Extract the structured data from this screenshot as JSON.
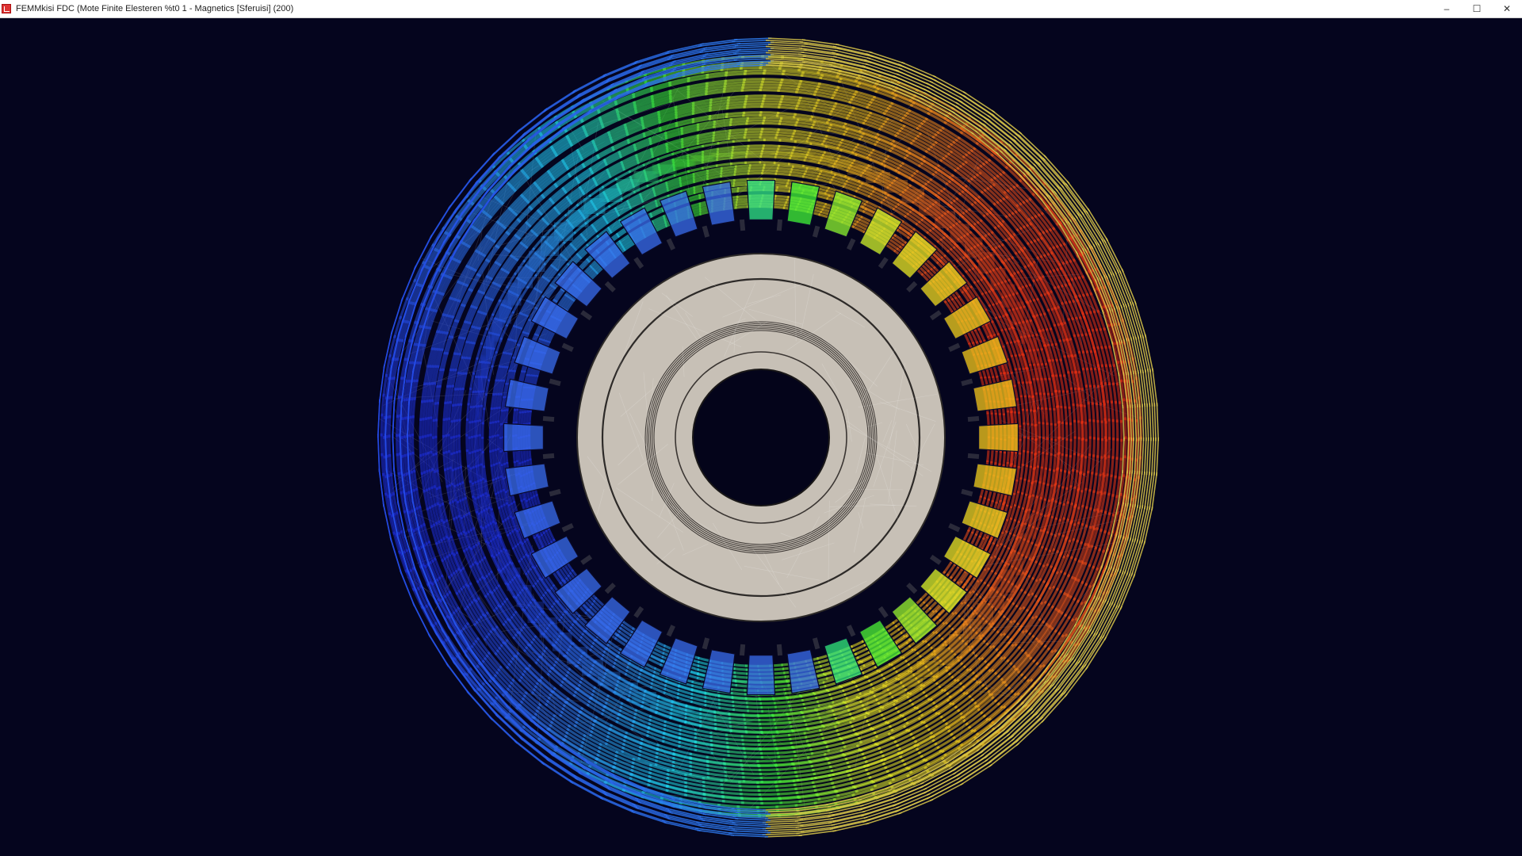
{
  "window": {
    "title": "FEMMkisi FDC (Mote Finite Elesteren %t0 1 - Magnetics [Sferuisi] (200)",
    "icon": "app-icon",
    "controls": {
      "minimize": "–",
      "maximize": "☐",
      "close": "✕"
    }
  },
  "viewport": {
    "background": "#05051e",
    "colormap": [
      "#1e2fe0",
      "#2f7cf0",
      "#1fd8f0",
      "#3df53a",
      "#e8f42a",
      "#f7c21a",
      "#f2601c",
      "#ea2a12"
    ],
    "geometry_colors": {
      "rotor_fill": "#c7c0b6",
      "slot_fill": "#3a6df0",
      "bore": "#04041a",
      "outer_ring": "#d8c54a"
    }
  }
}
